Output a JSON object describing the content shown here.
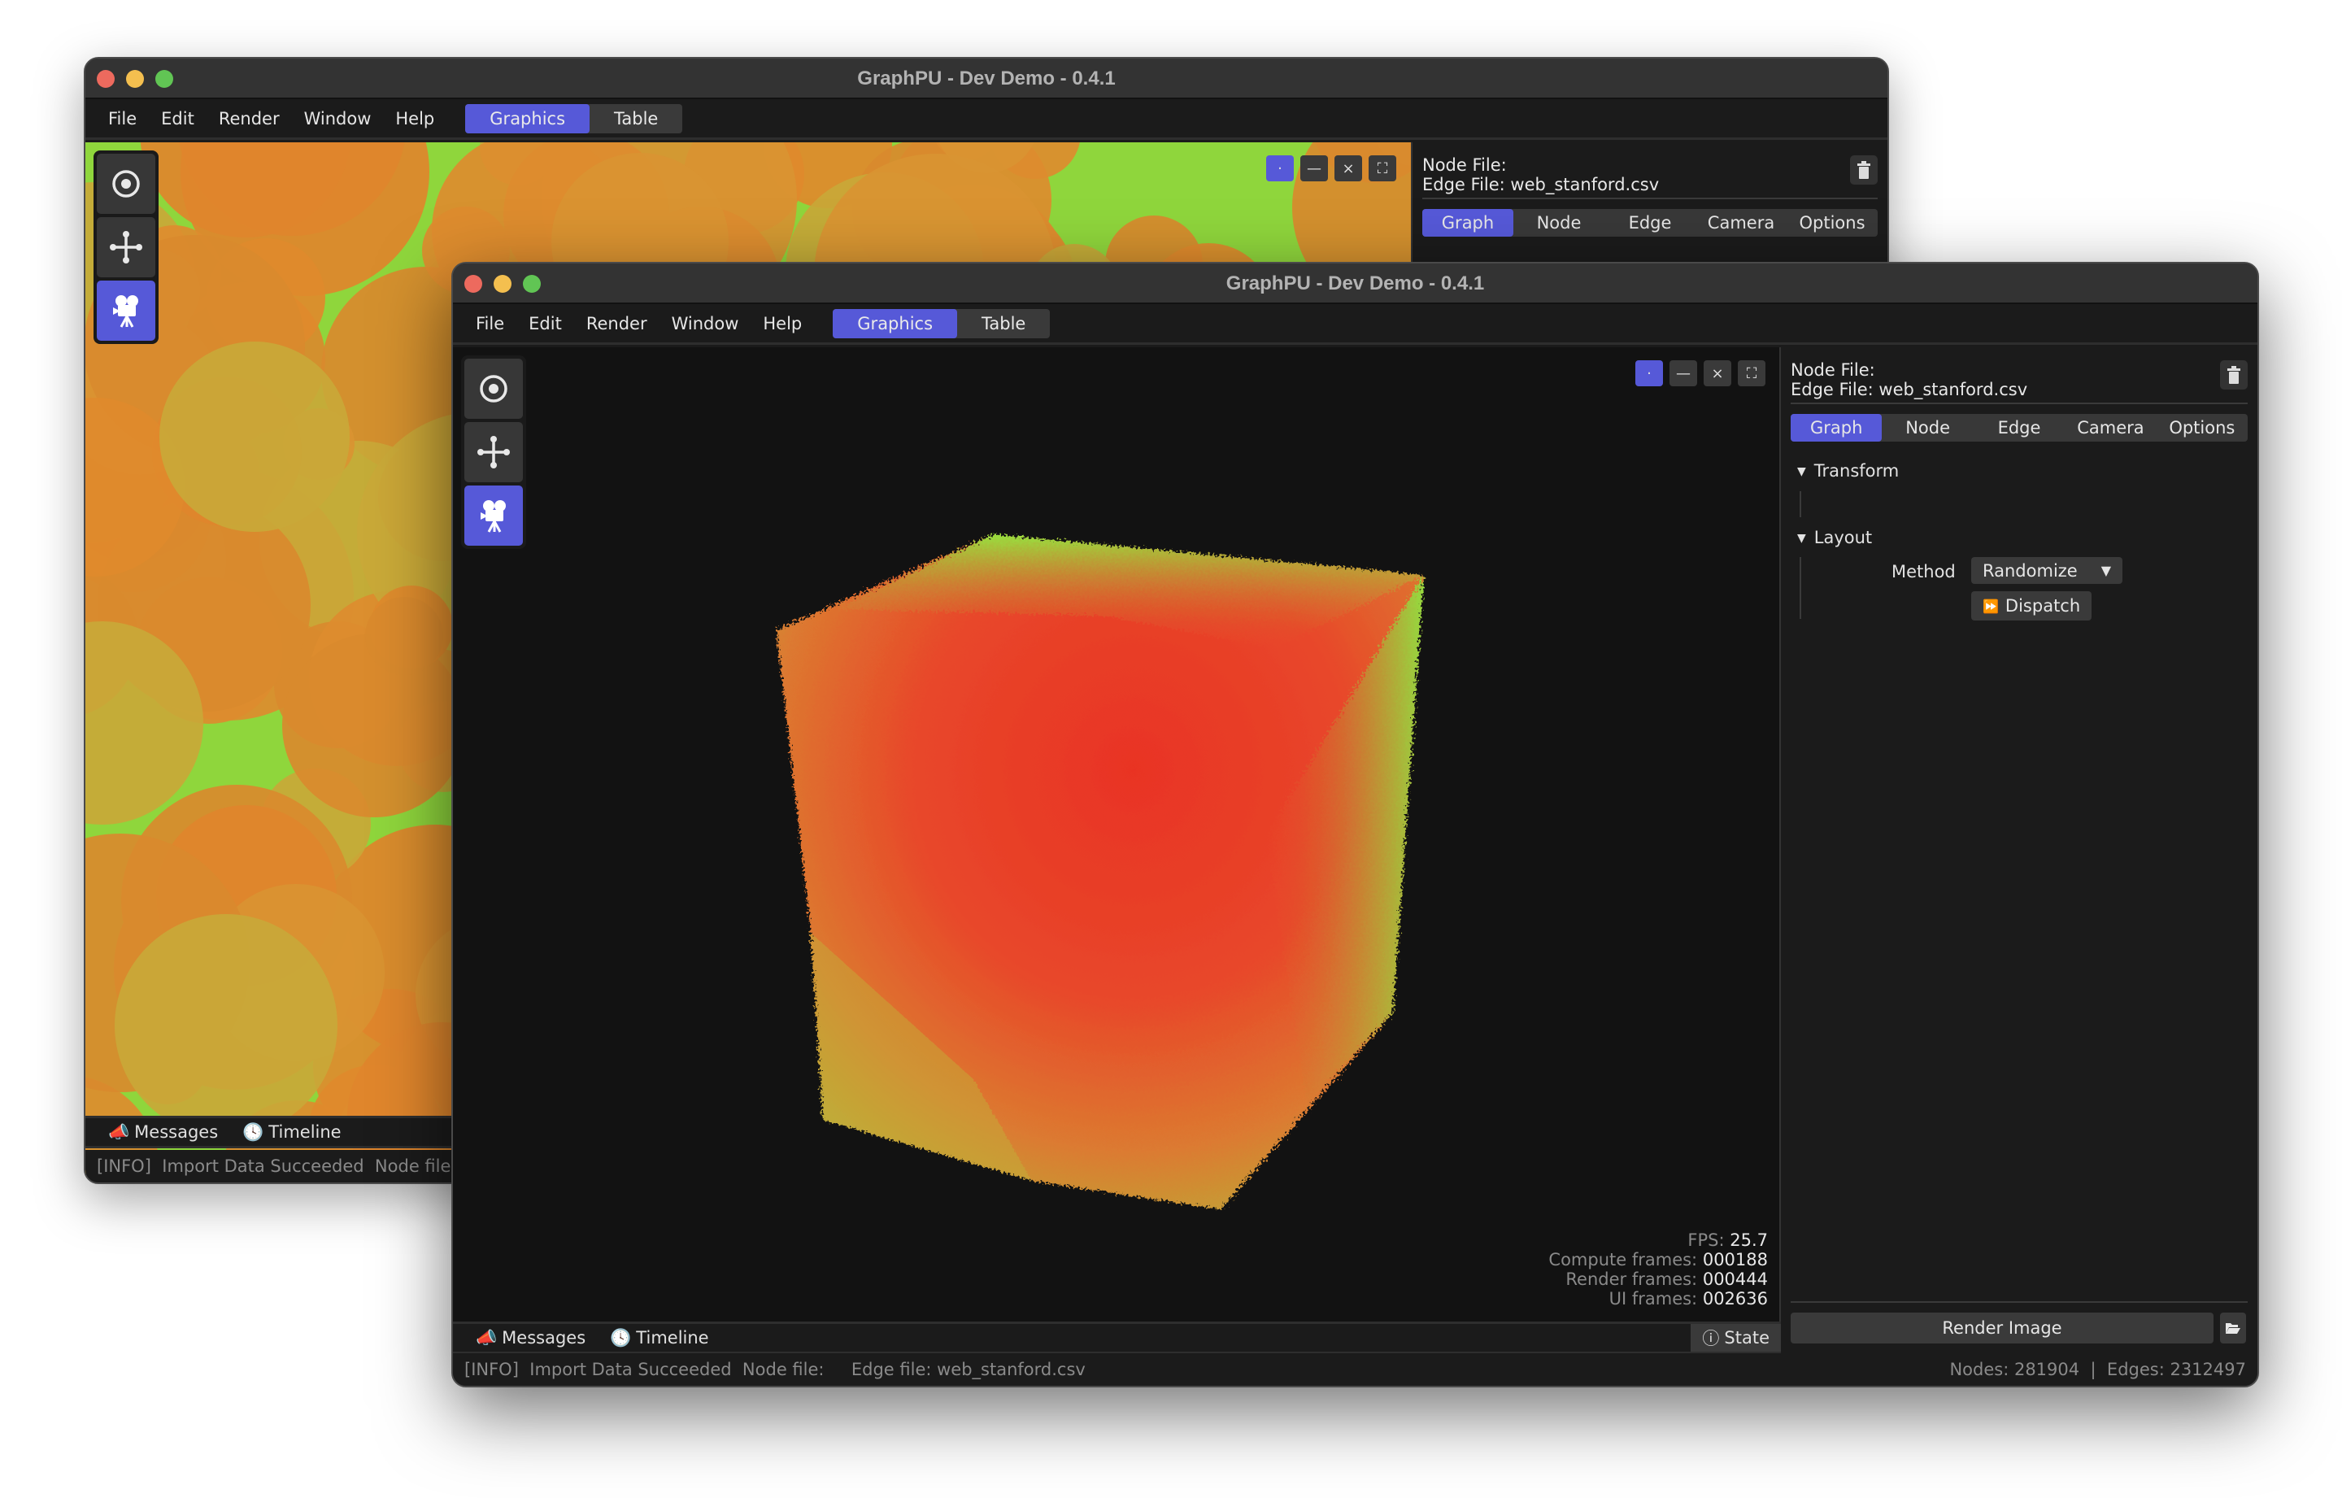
{
  "app": {
    "title": "GraphPU - Dev Demo - 0.4.1",
    "accent_color": "#5659d8"
  },
  "menubar": {
    "items": [
      "File",
      "Edit",
      "Render",
      "Window",
      "Help"
    ],
    "view_tabs": [
      {
        "label": "Graphics",
        "active": true
      },
      {
        "label": "Table",
        "active": false
      }
    ]
  },
  "toolbox": {
    "tools": [
      {
        "icon": "target-icon",
        "active": false
      },
      {
        "icon": "move-icon",
        "active": false
      },
      {
        "icon": "movie-camera-icon",
        "active": true
      }
    ]
  },
  "viewport_controls": {
    "buttons": [
      {
        "icon": "dot-icon",
        "glyph": "·",
        "active": true
      },
      {
        "icon": "minimize-icon",
        "glyph": "—",
        "active": false
      },
      {
        "icon": "close-icon",
        "glyph": "×",
        "active": false
      },
      {
        "icon": "fullscreen-icon",
        "glyph": "⛶",
        "active": false
      }
    ]
  },
  "side_panel": {
    "node_file_label": "Node File:",
    "edge_file_label": "Edge File: web_stanford.csv",
    "tabs": [
      {
        "label": "Graph",
        "active": true
      },
      {
        "label": "Node",
        "active": false
      },
      {
        "label": "Edge",
        "active": false
      },
      {
        "label": "Camera",
        "active": false
      },
      {
        "label": "Options",
        "active": false
      }
    ],
    "sections": {
      "transform": "Transform",
      "layout": "Layout"
    },
    "layout": {
      "method_label": "Method",
      "method_value": "Randomize",
      "dispatch_label": "Dispatch"
    },
    "render_image_label": "Render Image"
  },
  "stats": {
    "fps_label": "FPS:",
    "fps": "25.7",
    "compute_label": "Compute frames:",
    "compute": "000188",
    "render_label": "Render frames:",
    "render": "000444",
    "ui_label": "UI frames:",
    "ui": "002636"
  },
  "bottom_tabs": {
    "messages": "Messages",
    "timeline": "Timeline",
    "state": "State"
  },
  "statusbar": {
    "message": "[INFO]  Import Data Succeeded  Node file:     Edge file: web_stanford.csv",
    "message_back": "[INFO]  Import Data Succeeded  Node file:",
    "nodes": "Nodes: 281904",
    "edges": "Edges: 2312497",
    "separator": "|"
  }
}
